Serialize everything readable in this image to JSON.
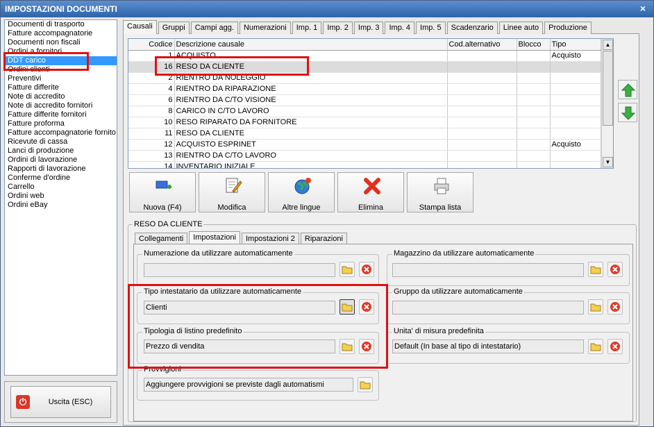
{
  "window": {
    "title": "IMPOSTAZIONI DOCUMENTI",
    "close_label": "×"
  },
  "doc_types": [
    "Documenti di trasporto",
    "Fatture accompagnatorie",
    "Documenti non fiscali",
    "Ordini a fornitori",
    "DDT carico",
    "Ordini clienti",
    "Preventivi",
    "Fatture differite",
    "Note di accredito",
    "Note di accredito fornitori",
    "Fatture differite fornitori",
    "Fatture proforma",
    "Fatture accompagnatorie fornito",
    "Ricevute di cassa",
    "Lanci di produzione",
    "Ordini di lavorazione",
    "Rapporti di lavorazione",
    "Conferme d'ordine",
    "Carrello",
    "Ordini web",
    "Ordini eBay"
  ],
  "selected_doc_type": "DDT carico",
  "exit_button": {
    "label": "Uscita (ESC)",
    "icon": "power-icon"
  },
  "main_tabs": [
    "Causali",
    "Gruppi",
    "Campi agg.",
    "Numerazioni",
    "Imp. 1",
    "Imp. 2",
    "Imp. 3",
    "Imp. 4",
    "Imp. 5",
    "Scadenzario",
    "Linee auto",
    "Produzione"
  ],
  "active_main_tab": "Causali",
  "causali_table": {
    "columns": [
      "Codice",
      "Descrizione causale",
      "Cod.alternativo",
      "Blocco",
      "Tipo"
    ],
    "rows": [
      {
        "codice": "1",
        "descrizione": "ACQUISTO",
        "cod_alt": "",
        "blocco": "",
        "tipo": "Acquisto"
      },
      {
        "codice": "16",
        "descrizione": "RESO DA CLIENTE",
        "cod_alt": "",
        "blocco": "",
        "tipo": ""
      },
      {
        "codice": "2",
        "descrizione": "RIENTRO DA NOLEGGIO",
        "cod_alt": "",
        "blocco": "",
        "tipo": ""
      },
      {
        "codice": "4",
        "descrizione": "RIENTRO DA RIPARAZIONE",
        "cod_alt": "",
        "blocco": "",
        "tipo": ""
      },
      {
        "codice": "6",
        "descrizione": "RIENTRO DA C/TO VISIONE",
        "cod_alt": "",
        "blocco": "",
        "tipo": ""
      },
      {
        "codice": "8",
        "descrizione": "CARICO IN C/TO LAVORO",
        "cod_alt": "",
        "blocco": "",
        "tipo": ""
      },
      {
        "codice": "10",
        "descrizione": "RESO RIPARATO DA FORNITORE",
        "cod_alt": "",
        "blocco": "",
        "tipo": ""
      },
      {
        "codice": "11",
        "descrizione": "RESO DA CLIENTE",
        "cod_alt": "",
        "blocco": "",
        "tipo": ""
      },
      {
        "codice": "12",
        "descrizione": "ACQUISTO ESPRINET",
        "cod_alt": "",
        "blocco": "",
        "tipo": "Acquisto"
      },
      {
        "codice": "13",
        "descrizione": "RIENTRO DA C/TO LAVORO",
        "cod_alt": "",
        "blocco": "",
        "tipo": ""
      },
      {
        "codice": "14",
        "descrizione": "INVENTARIO INIZIALE",
        "cod_alt": "",
        "blocco": "",
        "tipo": ""
      }
    ],
    "selected_row": 1
  },
  "toolbar": [
    {
      "label": "Nuova (F4)",
      "icon": "new-item-icon"
    },
    {
      "label": "Modifica",
      "icon": "edit-icon"
    },
    {
      "label": "Altre lingue",
      "icon": "globe-icon"
    },
    {
      "label": "Elimina",
      "icon": "delete-icon"
    },
    {
      "label": "Stampa lista",
      "icon": "printer-icon"
    }
  ],
  "detail": {
    "title": "RESO DA CLIENTE",
    "tabs": [
      "Collegamenti",
      "Impostazioni",
      "Impostazioni 2",
      "Riparazioni"
    ],
    "active_tab": "Impostazioni",
    "numerazione": {
      "label": "Numerazione da utilizzare automaticamente",
      "value": ""
    },
    "magazzino": {
      "label": "Magazzino da utilizzare automaticamente",
      "value": ""
    },
    "tipo_intestatario": {
      "label": "Tipo intestatario da utilizzare automaticamente",
      "value": "Clienti"
    },
    "gruppo": {
      "label": "Gruppo da utilizzare automaticamente",
      "value": ""
    },
    "tipologia_listino": {
      "label": "Tipologia di listino predefinito",
      "value": "Prezzo di vendita"
    },
    "unita_misura": {
      "label": "Unita' di misura predefinita",
      "value": "Default (In base al tipo di intestatario)"
    },
    "provvigioni": {
      "label": "Provvigioni",
      "value": "Aggiungere provvigioni se previste dagli automatismi"
    }
  },
  "colors": {
    "highlight": "#e01010",
    "selection": "#3399ff",
    "title_bar": "#2f63a8"
  }
}
